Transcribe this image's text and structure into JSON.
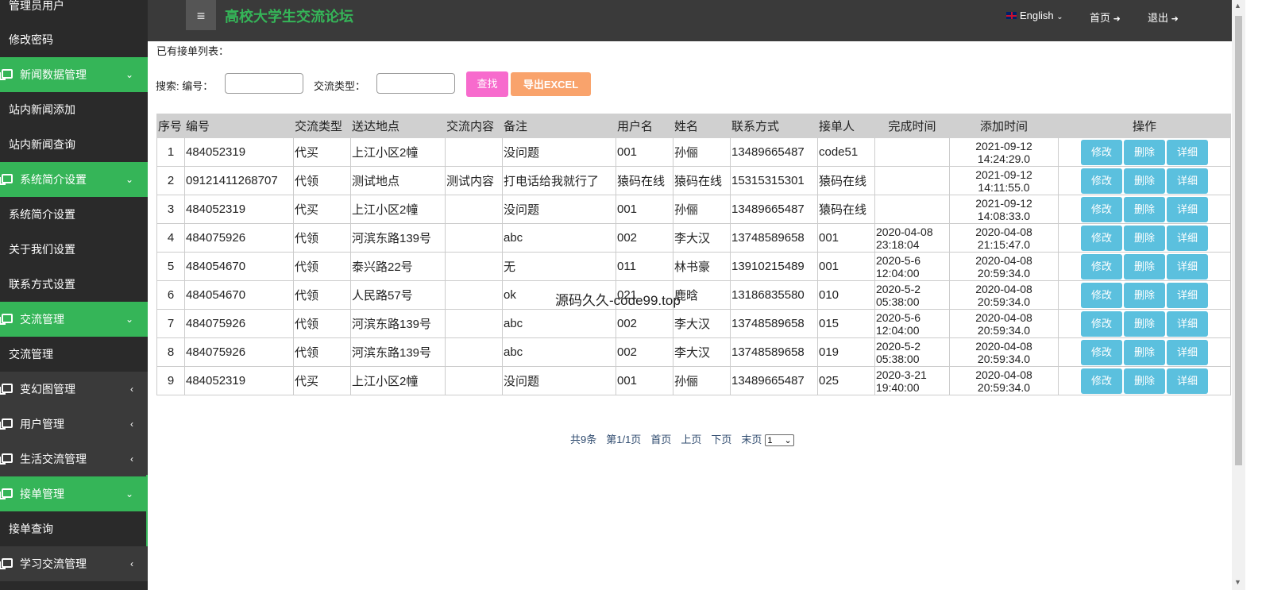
{
  "sidebar": {
    "top_item": "管理员用户",
    "items": [
      {
        "type": "sub",
        "label": "修改密码"
      },
      {
        "type": "group",
        "label": "新闻数据管理",
        "active": true,
        "chev": "⌄"
      },
      {
        "type": "sub",
        "label": "站内新闻添加"
      },
      {
        "type": "sub",
        "label": "站内新闻查询"
      },
      {
        "type": "group",
        "label": "系统简介设置",
        "active": true,
        "chev": "⌄"
      },
      {
        "type": "sub",
        "label": "系统简介设置"
      },
      {
        "type": "sub",
        "label": "关于我们设置"
      },
      {
        "type": "sub",
        "label": "联系方式设置"
      },
      {
        "type": "group",
        "label": "交流管理",
        "active": true,
        "chev": "⌄"
      },
      {
        "type": "sub",
        "label": "交流管理"
      },
      {
        "type": "group",
        "label": "变幻图管理",
        "active": false,
        "chev": "‹"
      },
      {
        "type": "group",
        "label": "用户管理",
        "active": false,
        "chev": "‹"
      },
      {
        "type": "group",
        "label": "生活交流管理",
        "active": false,
        "chev": "‹"
      },
      {
        "type": "group",
        "label": "接单管理",
        "active": true,
        "chev": "⌄"
      },
      {
        "type": "sub",
        "label": "接单查询",
        "selected": true
      },
      {
        "type": "group",
        "label": "学习交流管理",
        "active": false,
        "chev": "‹"
      }
    ]
  },
  "header": {
    "menu_icon": "≡",
    "title": "高校大学生交流论坛",
    "language": "English",
    "home": "首页",
    "logout": "退出"
  },
  "content": {
    "list_title": "已有接单列表：",
    "search_label": "搜索: 编号：",
    "type_label": "交流类型：",
    "find_button": "查找",
    "export_button": "导出EXCEL"
  },
  "table": {
    "headers": [
      "序号",
      "编号",
      "交流类型",
      "送达地点",
      "交流内容",
      "备注",
      "用户名",
      "姓名",
      "联系方式",
      "接单人",
      "完成时间",
      "添加时间",
      "操作"
    ],
    "rows": [
      {
        "no": "1",
        "code": "484052319",
        "type": "代买",
        "place": "上江小区2幢",
        "content": "",
        "note": "没问题",
        "user": "001",
        "name": "孙俪",
        "phone": "13489665487",
        "taker": "code51",
        "done_date": "",
        "done_time": "",
        "add_date": "2021-09-12",
        "add_time": "14:24:29.0"
      },
      {
        "no": "2",
        "code": "09121411268707",
        "type": "代领",
        "place": "测试地点",
        "content": "测试内容",
        "note": "打电话给我就行了",
        "user": "猿码在线",
        "name": "猿码在线",
        "phone": "15315315301",
        "taker": "猿码在线",
        "done_date": "",
        "done_time": "",
        "add_date": "2021-09-12",
        "add_time": "14:11:55.0"
      },
      {
        "no": "3",
        "code": "484052319",
        "type": "代买",
        "place": "上江小区2幢",
        "content": "",
        "note": "没问题",
        "user": "001",
        "name": "孙俪",
        "phone": "13489665487",
        "taker": "猿码在线",
        "done_date": "",
        "done_time": "",
        "add_date": "2021-09-12",
        "add_time": "14:08:33.0"
      },
      {
        "no": "4",
        "code": "484075926",
        "type": "代领",
        "place": "河滨东路139号",
        "content": "",
        "note": "abc",
        "user": "002",
        "name": "李大汉",
        "phone": "13748589658",
        "taker": "001",
        "done_date": "2020-04-08",
        "done_time": "23:18:04",
        "add_date": "2020-04-08",
        "add_time": "21:15:47.0"
      },
      {
        "no": "5",
        "code": "484054670",
        "type": "代领",
        "place": "泰兴路22号",
        "content": "",
        "note": "无",
        "user": "011",
        "name": "林书豪",
        "phone": "13910215489",
        "taker": "001",
        "done_date": "2020-5-6",
        "done_time": "12:04:00",
        "add_date": "2020-04-08",
        "add_time": "20:59:34.0"
      },
      {
        "no": "6",
        "code": "484054670",
        "type": "代领",
        "place": "人民路57号",
        "content": "",
        "note": "ok",
        "user": "021",
        "name": "鹿晗",
        "phone": "13186835580",
        "taker": "010",
        "done_date": "2020-5-2",
        "done_time": "05:38:00",
        "add_date": "2020-04-08",
        "add_time": "20:59:34.0"
      },
      {
        "no": "7",
        "code": "484075926",
        "type": "代领",
        "place": "河滨东路139号",
        "content": "",
        "note": "abc",
        "user": "002",
        "name": "李大汉",
        "phone": "13748589658",
        "taker": "015",
        "done_date": "2020-5-6",
        "done_time": "12:04:00",
        "add_date": "2020-04-08",
        "add_time": "20:59:34.0"
      },
      {
        "no": "8",
        "code": "484075926",
        "type": "代领",
        "place": "河滨东路139号",
        "content": "",
        "note": "abc",
        "user": "002",
        "name": "李大汉",
        "phone": "13748589658",
        "taker": "019",
        "done_date": "2020-5-2",
        "done_time": "05:38:00",
        "add_date": "2020-04-08",
        "add_time": "20:59:34.0"
      },
      {
        "no": "9",
        "code": "484052319",
        "type": "代买",
        "place": "上江小区2幢",
        "content": "",
        "note": "没问题",
        "user": "001",
        "name": "孙俪",
        "phone": "13489665487",
        "taker": "025",
        "done_date": "2020-3-21",
        "done_time": "19:40:00",
        "add_date": "2020-04-08",
        "add_time": "20:59:34.0"
      }
    ],
    "ops": {
      "edit": "修改",
      "delete": "删除",
      "detail": "详细"
    }
  },
  "pager": {
    "total": "共9条",
    "page": "第1/1页",
    "first": "首页",
    "prev": "上页",
    "next": "下页",
    "last": "末页",
    "selected": "1"
  },
  "watermark": "源码久久-code99.top"
}
